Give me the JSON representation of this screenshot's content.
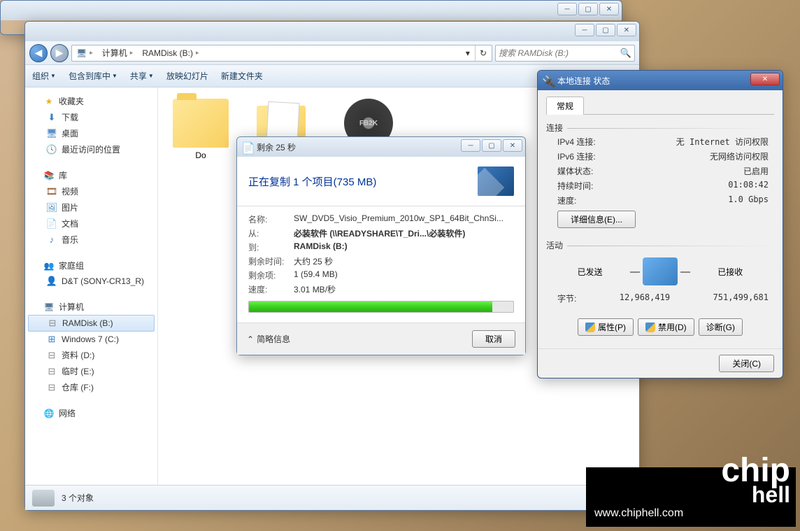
{
  "explorer": {
    "breadcrumb": {
      "root_icon": "computer",
      "seg1": "计算机",
      "seg2": "RAMDisk (B:)"
    },
    "search_placeholder": "搜索 RAMDisk (B:)",
    "toolbar": {
      "organize": "组织",
      "include": "包含到库中",
      "share": "共享",
      "slideshow": "放映幻灯片",
      "newfolder": "新建文件夹"
    },
    "sidebar": {
      "favorites": {
        "head": "收藏夹",
        "items": [
          "下载",
          "桌面",
          "最近访问的位置"
        ]
      },
      "libraries": {
        "head": "库",
        "items": [
          "视频",
          "图片",
          "文档",
          "音乐"
        ]
      },
      "homegroup": {
        "head": "家庭组",
        "items": [
          "D&T (SONY-CR13_R)"
        ]
      },
      "computer": {
        "head": "计算机",
        "items": [
          "RAMDisk (B:)",
          "Windows 7 (C:)",
          "资料 (D:)",
          "临时 (E:)",
          "仓库 (F:)"
        ]
      },
      "network": {
        "head": "网络"
      }
    },
    "content": {
      "item1": "Do",
      "item3_badge": "FB2K"
    },
    "status": {
      "count": "3 个对象"
    }
  },
  "copy": {
    "title": "剩余 25 秒",
    "header": "正在复制 1 个项目(735 MB)",
    "rows": {
      "name_lbl": "名称:",
      "name_val": "SW_DVD5_Visio_Premium_2010w_SP1_64Bit_ChnSi...",
      "from_lbl": "从:",
      "from_val": "必装软件 (\\\\READYSHARE\\T_Dri...\\必装软件)",
      "to_lbl": "到:",
      "to_val": "RAMDisk (B:)",
      "time_lbl": "剩余时间:",
      "time_val": "大约 25 秒",
      "items_lbl": "剩余项:",
      "items_val": "1 (59.4 MB)",
      "speed_lbl": "速度:",
      "speed_val": "3.01 MB/秒"
    },
    "less_info": "简略信息",
    "cancel": "取消"
  },
  "net": {
    "title": "本地连接 状态",
    "tab": "常规",
    "conn": {
      "head": "连接",
      "ipv4_lbl": "IPv4 连接:",
      "ipv4_val": "无 Internet 访问权限",
      "ipv6_lbl": "IPv6 连接:",
      "ipv6_val": "无网络访问权限",
      "media_lbl": "媒体状态:",
      "media_val": "已启用",
      "dur_lbl": "持续时间:",
      "dur_val": "01:08:42",
      "speed_lbl": "速度:",
      "speed_val": "1.0 Gbps",
      "details_btn": "详细信息(E)..."
    },
    "activity": {
      "head": "活动",
      "sent": "已发送",
      "recv": "已接收",
      "bytes_lbl": "字节:",
      "sent_val": "12,968,419",
      "recv_val": "751,499,681"
    },
    "btns": {
      "props": "属性(P)",
      "disable": "禁用(D)",
      "diag": "诊断(G)"
    },
    "close": "关闭(C)"
  },
  "watermark": {
    "url": "www.chiphell.com",
    "logo1": "chip",
    "logo2": "hell"
  }
}
